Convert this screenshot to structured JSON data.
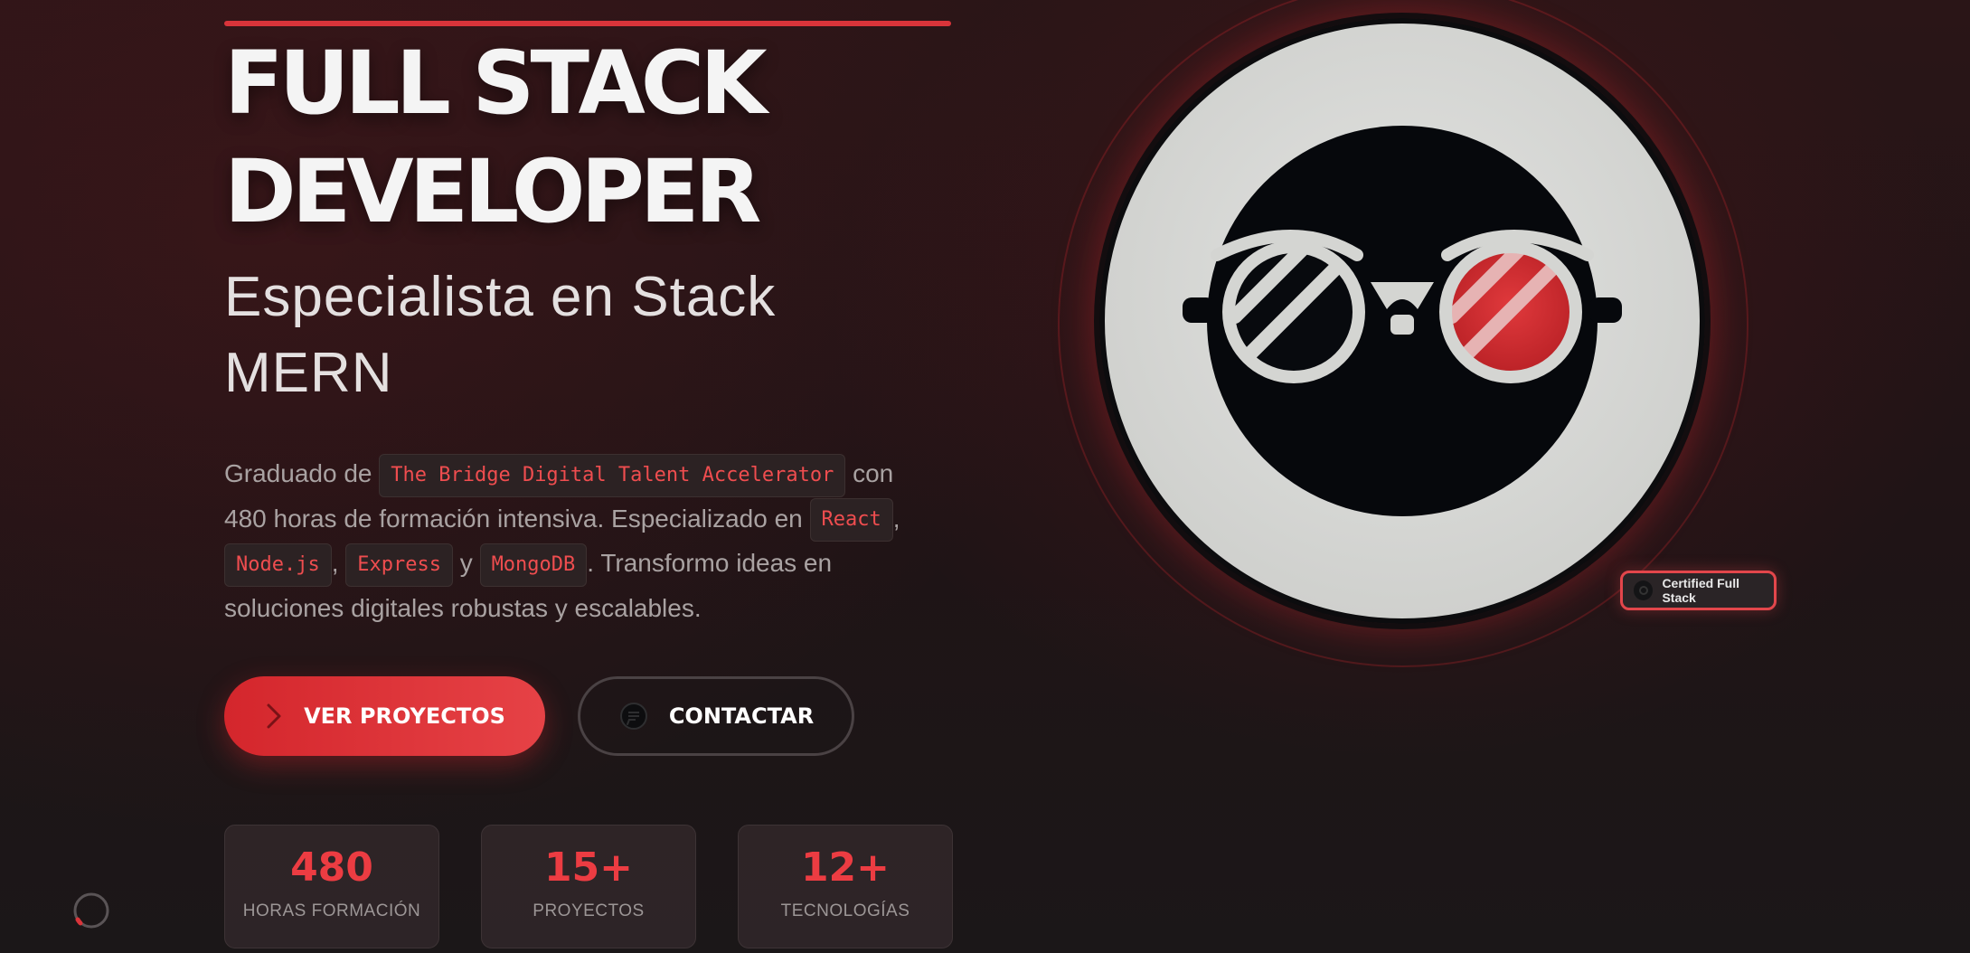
{
  "hero": {
    "title_line1": "FULL STACK",
    "title_line2": "DEVELOPER",
    "subtitle_line1": "Especialista en Stack",
    "subtitle_line2": "MERN"
  },
  "description": {
    "part1": "Graduado de ",
    "school": "The Bridge Digital Talent Accelerator",
    "part2": " con 480 horas de formación intensiva. Especializado en ",
    "tech1": "React",
    "sep1": ", ",
    "tech2": "Node.js",
    "sep2": ", ",
    "tech3": "Express",
    "sep3": " y ",
    "tech4": "MongoDB",
    "part3": ". Transformo ideas en soluciones digitales robustas y escalables."
  },
  "buttons": {
    "primary_label": "VER PROYECTOS",
    "secondary_label": "CONTACTAR"
  },
  "stats": [
    {
      "value": "480",
      "label": "HORAS FORMACIÓN"
    },
    {
      "value": "15+",
      "label": "PROYECTOS"
    },
    {
      "value": "12+",
      "label": "TECNOLOGÍAS"
    }
  ],
  "badge": {
    "label": "Certified Full Stack"
  },
  "icons": {
    "primary_button": "chevron-right-icon",
    "secondary_button": "chat-icon",
    "avatar": "glasses-avatar",
    "loader": "loading-spinner-icon"
  },
  "colors": {
    "accent": "#e2343a",
    "background": "#1f1416",
    "text": "#f4f4f4",
    "muted": "#a9a2a2"
  }
}
